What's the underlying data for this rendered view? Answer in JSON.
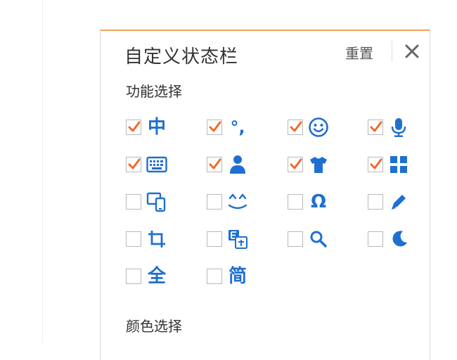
{
  "panel": {
    "title": "自定义状态栏",
    "reset_label": "重置",
    "accent_color": "#f0a15a",
    "icon_color": "#1f6fd1",
    "check_color": "#f06a2a"
  },
  "function_section": {
    "title": "功能选择",
    "items": [
      {
        "icon": "chinese-mode-icon",
        "glyph": "中",
        "checked": true
      },
      {
        "icon": "punctuation-icon",
        "glyph": "°,",
        "checked": true
      },
      {
        "icon": "emoji-smile-icon",
        "checked": true
      },
      {
        "icon": "microphone-icon",
        "checked": true
      },
      {
        "icon": "keyboard-icon",
        "checked": true
      },
      {
        "icon": "user-account-icon",
        "checked": true
      },
      {
        "icon": "tshirt-skin-icon",
        "checked": true
      },
      {
        "icon": "toolbox-grid-icon",
        "checked": true
      },
      {
        "icon": "device-sync-icon",
        "checked": false
      },
      {
        "icon": "kaomoji-icon",
        "checked": false
      },
      {
        "icon": "special-symbol-omega-icon",
        "glyph": "Ω",
        "checked": false
      },
      {
        "icon": "handwriting-pencil-icon",
        "checked": false
      },
      {
        "icon": "crop-screenshot-icon",
        "checked": false
      },
      {
        "icon": "translate-icon",
        "checked": false
      },
      {
        "icon": "search-icon",
        "checked": false
      },
      {
        "icon": "night-mode-moon-icon",
        "checked": false
      },
      {
        "icon": "full-width-icon",
        "glyph": "全",
        "checked": false
      },
      {
        "icon": "simplified-chinese-icon",
        "glyph": "简",
        "checked": false
      }
    ]
  },
  "color_section": {
    "title": "颜色选择"
  }
}
